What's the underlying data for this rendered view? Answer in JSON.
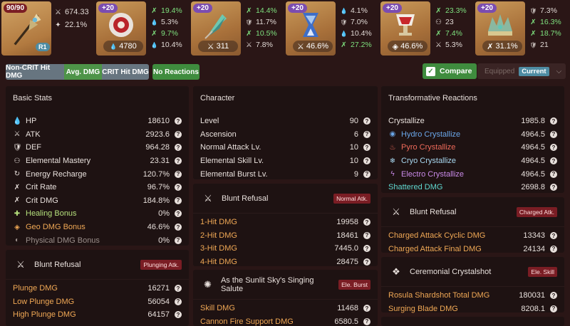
{
  "weapon": {
    "level_badge": "90/90",
    "refine_badge": "R1",
    "stats": [
      {
        "icon": "sword-icon",
        "glyph": "⚔",
        "value": "674.33"
      },
      {
        "icon": "crit-icon",
        "glyph": "✦",
        "value": "22.1%"
      }
    ]
  },
  "artifacts": [
    {
      "name": "flower",
      "plus": "+20",
      "main_icon": "hp-icon",
      "main_glyph": "💧",
      "main_value": "4780",
      "subs": [
        {
          "icon": "crit-dmg-icon",
          "glyph": "✗",
          "value": "19.4%",
          "hi": true
        },
        {
          "icon": "hp-pct-icon",
          "glyph": "💧",
          "value": "5.3%",
          "hi": false
        },
        {
          "icon": "crit-rate-icon",
          "glyph": "✗",
          "value": "9.7%",
          "hi": true
        },
        {
          "icon": "hp-pct-icon",
          "glyph": "💧",
          "value": "10.4%",
          "hi": false
        }
      ]
    },
    {
      "name": "plume",
      "plus": "+20",
      "main_icon": "atk-icon",
      "main_glyph": "⚔",
      "main_value": "311",
      "subs": [
        {
          "icon": "crit-dmg-icon",
          "glyph": "✗",
          "value": "14.4%",
          "hi": true
        },
        {
          "icon": "def-pct-icon",
          "glyph": "🛡",
          "value": "11.7%",
          "hi": false
        },
        {
          "icon": "crit-rate-icon",
          "glyph": "✗",
          "value": "10.5%",
          "hi": true
        },
        {
          "icon": "atk-pct-icon",
          "glyph": "⚔",
          "value": "7.8%",
          "hi": false
        }
      ]
    },
    {
      "name": "sands",
      "plus": "+20",
      "main_icon": "atk-pct-icon",
      "main_glyph": "⚔",
      "main_value": "46.6%",
      "subs": [
        {
          "icon": "hp-pct-icon",
          "glyph": "💧",
          "value": "4.1%",
          "hi": false
        },
        {
          "icon": "def-pct-icon",
          "glyph": "🛡",
          "value": "7.0%",
          "hi": false
        },
        {
          "icon": "hp-pct-icon",
          "glyph": "💧",
          "value": "10.4%",
          "hi": false
        },
        {
          "icon": "crit-dmg-icon",
          "glyph": "✗",
          "value": "27.2%",
          "hi": true
        }
      ]
    },
    {
      "name": "goblet",
      "plus": "+20",
      "main_icon": "geo-dmg-icon",
      "main_glyph": "◈",
      "main_value": "46.6%",
      "subs": [
        {
          "icon": "crit-dmg-icon",
          "glyph": "✗",
          "value": "23.3%",
          "hi": true
        },
        {
          "icon": "em-icon",
          "glyph": "⚇",
          "value": "23",
          "hi": false
        },
        {
          "icon": "crit-rate-icon",
          "glyph": "✗",
          "value": "7.4%",
          "hi": true
        },
        {
          "icon": "atk-pct-icon",
          "glyph": "⚔",
          "value": "5.3%",
          "hi": false
        }
      ]
    },
    {
      "name": "circlet",
      "plus": "+20",
      "main_icon": "crit-rate-icon",
      "main_glyph": "✗",
      "main_value": "31.1%",
      "subs": [
        {
          "icon": "def-pct-icon",
          "glyph": "🛡",
          "value": "7.3%",
          "hi": false
        },
        {
          "icon": "crit-dmg-icon",
          "glyph": "✗",
          "value": "16.3%",
          "hi": true
        },
        {
          "icon": "atk-pct-icon",
          "glyph": "✗",
          "value": "18.7%",
          "hi": true
        },
        {
          "icon": "def-icon",
          "glyph": "🛡",
          "value": "21",
          "hi": false
        }
      ]
    }
  ],
  "filters": {
    "noncrit": "Non-CRIT Hit DMG",
    "avg": "Avg. DMG",
    "crit": "CRIT Hit DMG",
    "noreact": "No Reactions"
  },
  "compare": {
    "label": "Compare",
    "check": "✓"
  },
  "equipped": {
    "label": "Equipped",
    "current": "Current"
  },
  "basic_stats": {
    "title": "Basic Stats",
    "rows": [
      {
        "label": "HP",
        "value": "18610",
        "glyph": "💧",
        "icon": "hp-icon"
      },
      {
        "label": "ATK",
        "value": "2923.6",
        "glyph": "⚔",
        "icon": "atk-icon"
      },
      {
        "label": "DEF",
        "value": "964.28",
        "glyph": "🛡",
        "icon": "def-icon"
      },
      {
        "label": "Elemental Mastery",
        "value": "23.31",
        "glyph": "⚇",
        "icon": "em-icon"
      },
      {
        "label": "Energy Recharge",
        "value": "120.7%",
        "glyph": "↻",
        "icon": "er-icon"
      },
      {
        "label": "Crit Rate",
        "value": "96.7%",
        "glyph": "✗",
        "icon": "crit-rate-icon"
      },
      {
        "label": "Crit DMG",
        "value": "184.8%",
        "glyph": "✗",
        "icon": "crit-dmg-icon"
      },
      {
        "label": "Healing Bonus",
        "value": "0%",
        "glyph": "✚",
        "icon": "healing-icon"
      },
      {
        "label": "Geo DMG Bonus",
        "value": "46.6%",
        "glyph": "◈",
        "icon": "geo-icon"
      },
      {
        "label": "Physical DMG Bonus",
        "value": "0%",
        "glyph": "◐",
        "icon": "physical-icon"
      }
    ]
  },
  "plunge": {
    "title": "Blunt Refusal",
    "tag": "Plunging Atk.",
    "rows": [
      {
        "label": "Plunge DMG",
        "value": "16271"
      },
      {
        "label": "Low Plunge DMG",
        "value": "56054"
      },
      {
        "label": "High Plunge DMG",
        "value": "64157"
      }
    ]
  },
  "character": {
    "title": "Character",
    "rows": [
      {
        "label": "Level",
        "value": "90"
      },
      {
        "label": "Ascension",
        "value": "6"
      },
      {
        "label": "Normal Attack Lv.",
        "value": "10"
      },
      {
        "label": "Elemental Skill Lv.",
        "value": "10"
      },
      {
        "label": "Elemental Burst Lv.",
        "value": "9"
      }
    ]
  },
  "normal_atk": {
    "title": "Blunt Refusal",
    "tag": "Normal Atk.",
    "rows": [
      {
        "label": "1-Hit DMG",
        "value": "19958"
      },
      {
        "label": "2-Hit DMG",
        "value": "18461"
      },
      {
        "label": "3-Hit DMG",
        "value": "7445.0"
      },
      {
        "label": "4-Hit DMG",
        "value": "28475"
      }
    ]
  },
  "burst": {
    "title": "As the Sunlit Sky's Singing Salute",
    "tag": "Ele. Burst",
    "rows": [
      {
        "label": "Skill DMG",
        "value": "11468"
      },
      {
        "label": "Cannon Fire Support DMG",
        "value": "6580.5"
      }
    ]
  },
  "transformative": {
    "title": "Transformative Reactions",
    "rows": [
      {
        "label": "Crystallize",
        "value": "1985.8",
        "cls": "",
        "glyph": "",
        "icon": ""
      },
      {
        "label": "Hydro Crystallize",
        "value": "4964.5",
        "cls": "hydro",
        "glyph": "◉",
        "icon": "hydro-icon"
      },
      {
        "label": "Pyro Crystallize",
        "value": "4964.5",
        "cls": "pyro",
        "glyph": "♨",
        "icon": "pyro-icon"
      },
      {
        "label": "Cryo Crystallize",
        "value": "4964.5",
        "cls": "cryo",
        "glyph": "❄",
        "icon": "cryo-icon"
      },
      {
        "label": "Electro Crystallize",
        "value": "4964.5",
        "cls": "electro",
        "glyph": "ϟ",
        "icon": "electro-icon"
      },
      {
        "label": "Shattered DMG",
        "value": "2698.8",
        "cls": "teal",
        "glyph": "",
        "icon": ""
      }
    ]
  },
  "charged": {
    "title": "Blunt Refusal",
    "tag": "Charged Atk.",
    "rows": [
      {
        "label": "Charged Attack Cyclic DMG",
        "value": "13343"
      },
      {
        "label": "Charged Attack Final DMG",
        "value": "24134"
      }
    ]
  },
  "skill": {
    "title": "Ceremonial Crystalshot",
    "tag": "Ele. Skill",
    "rows": [
      {
        "label": "Rosula Shardshot Total DMG",
        "value": "180031"
      },
      {
        "label": "Surging Blade DMG",
        "value": "8208.1"
      }
    ]
  },
  "help_glyph": "?"
}
